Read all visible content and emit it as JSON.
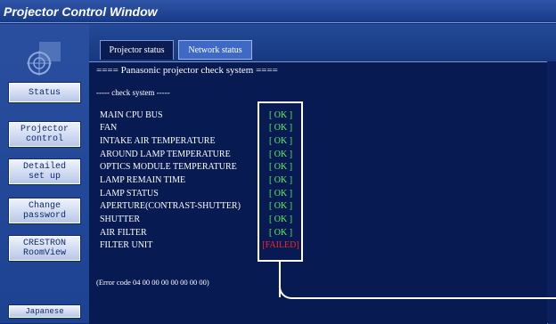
{
  "window": {
    "title": "Projector Control Window"
  },
  "sidebar": {
    "items": [
      {
        "id": "status",
        "label": "Status"
      },
      {
        "id": "projector-control",
        "label": "Projector\ncontrol"
      },
      {
        "id": "detailed-setup",
        "label": "Detailed\nset up"
      },
      {
        "id": "change-password",
        "label": "Change\npassword"
      },
      {
        "id": "crestron",
        "label": "CRESTRON\nRoomView"
      }
    ],
    "language_button": "Japanese"
  },
  "tabs": [
    {
      "label": "Projector status",
      "active": true
    },
    {
      "label": "Network status",
      "active": false
    }
  ],
  "content": {
    "header": "==== Panasonic projector check system ====",
    "subheader": "----- check system -----",
    "checks": [
      {
        "name": "MAIN CPU BUS",
        "result": "[ OK ]",
        "status": "ok"
      },
      {
        "name": "FAN",
        "result": "[ OK ]",
        "status": "ok"
      },
      {
        "name": "INTAKE AIR TEMPERATURE",
        "result": "[ OK ]",
        "status": "ok"
      },
      {
        "name": "AROUND LAMP TEMPERATURE",
        "result": "[ OK ]",
        "status": "ok"
      },
      {
        "name": "OPTICS MODULE TEMPERATURE",
        "result": "[ OK ]",
        "status": "ok"
      },
      {
        "name": "LAMP REMAIN TIME",
        "result": "[ OK ]",
        "status": "ok"
      },
      {
        "name": "LAMP STATUS",
        "result": "[ OK ]",
        "status": "ok"
      },
      {
        "name": "APERTURE(CONTRAST-SHUTTER)",
        "result": "[ OK ]",
        "status": "ok"
      },
      {
        "name": "SHUTTER",
        "result": "[ OK ]",
        "status": "ok"
      },
      {
        "name": "AIR FILTER",
        "result": "[ OK ]",
        "status": "ok"
      },
      {
        "name": "FILTER UNIT",
        "result": "[FAILED]",
        "status": "failed"
      }
    ],
    "error_code": "(Error code 04 00 00 00 00 00 00 00)"
  },
  "colors": {
    "ok": "#5ff25f",
    "failed": "#ff2424",
    "background": "#071a52",
    "highlight": "#ffffff"
  }
}
